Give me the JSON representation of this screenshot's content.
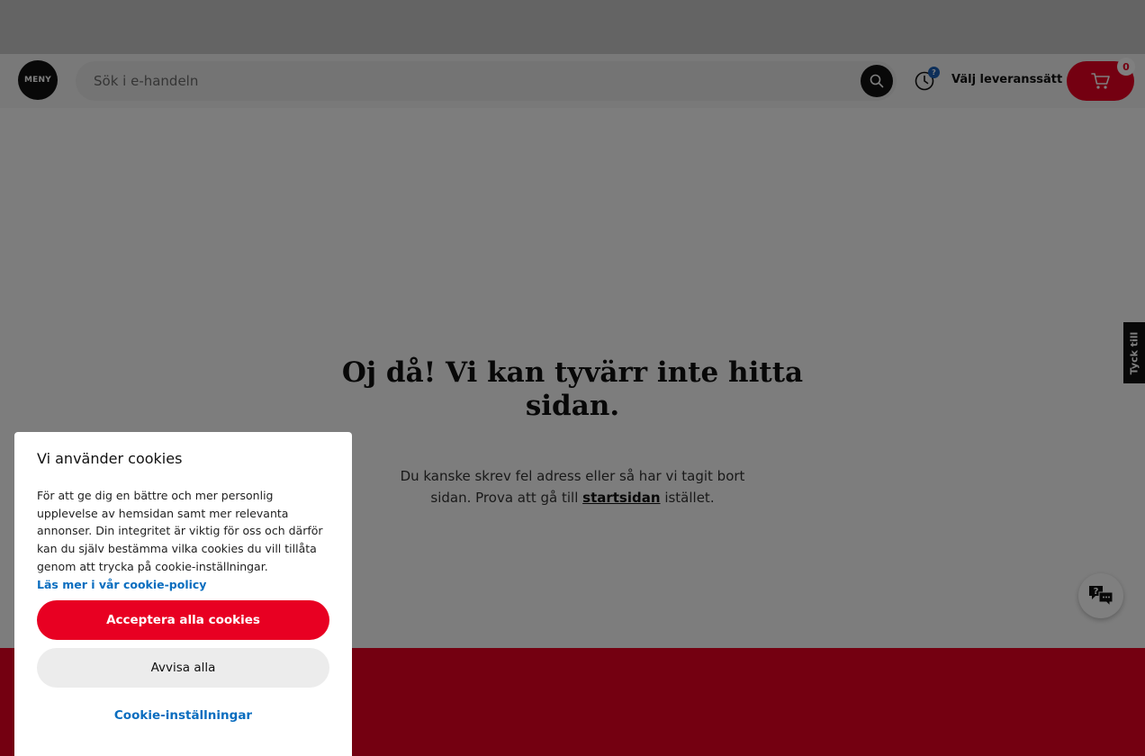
{
  "header": {
    "logo_text": "MENY",
    "search_placeholder": "Sök i e-handeln",
    "search_icon": "search-icon",
    "history_icon": "clock-icon",
    "history_badge": "?",
    "delivery_label": "Välj leveranssätt",
    "cart_icon": "cart-icon",
    "cart_count": "0"
  },
  "main": {
    "title": "Oj då! Vi kan tyvärr inte hitta sidan.",
    "text_before": "Du kanske skrev fel adress eller så har vi tagit bort sidan. Prova att gå till ",
    "link_text": "startsidan",
    "text_after": " istället."
  },
  "feedback_tab": "Tyck till",
  "help_icon": "chat-help-icon",
  "cookie": {
    "title": "Vi använder cookies",
    "body": "För att ge dig en bättre och mer personlig upplevelse av hemsidan samt mer relevanta annonser. Din integritet är viktig för oss och därför kan du själv bestämma vilka cookies du vill tillåta genom att trycka på cookie-inställningar.",
    "policy_link": "Läs mer i vår cookie-policy",
    "accept_label": "Acceptera alla cookies",
    "reject_label": "Avvisa alla",
    "settings_label": "Cookie-inställningar"
  },
  "colors": {
    "brand_red": "#e80022",
    "link_blue": "#0a6dbf",
    "badge_blue": "#1b5fb5"
  }
}
